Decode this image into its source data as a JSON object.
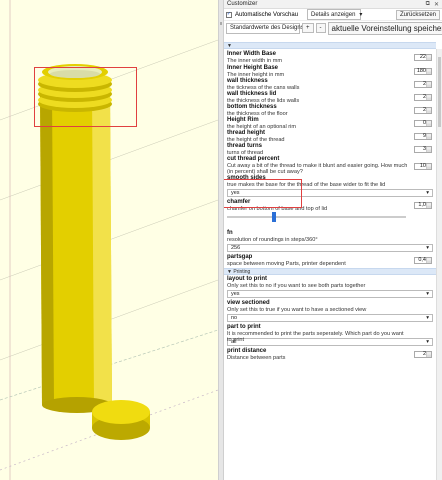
{
  "window": {
    "title": "Customizer",
    "controls": [
      "–",
      "⧉",
      "✕"
    ]
  },
  "toolbar": {
    "auto_preview_label": "Automatische Vorschau",
    "auto_preview_checked": true,
    "show_details": "Details anzeigen",
    "reset_label": "Zurücksetzen"
  },
  "presets": {
    "selected": "Standardwerte des Designs",
    "add_label": "+",
    "remove_label": "-",
    "save_label": "aktuelle Voreinstellung speichern"
  },
  "parameters": [
    {
      "name": "Inner Width Base",
      "desc": "The inner width in mm",
      "value": "22"
    },
    {
      "name": "Inner Height Base",
      "desc": "The inner height in mm",
      "value": "180"
    },
    {
      "name": "wall thickness",
      "desc": "the tickness of the cans walls",
      "value": "2"
    },
    {
      "name": "wall thickness lid",
      "desc": "the thickness of the lids walls",
      "value": "2"
    },
    {
      "name": "bottom thickness",
      "desc": "the thickness of the floor",
      "value": "2"
    },
    {
      "name": "Height Rim",
      "desc": "the height of an optional rim",
      "value": "0"
    },
    {
      "name": "thread height",
      "desc": "the height of the thread",
      "value": "9"
    },
    {
      "name": "thread turns",
      "desc": "turns of thread",
      "value": "3"
    },
    {
      "name": "cut thread percent",
      "desc": "Cut away a bit of the thread to make it blunt and easier going. How much (in percent) shall be cut away?",
      "value": "10"
    }
  ],
  "smooth_sides": {
    "name": "smooth sides",
    "desc": "true makes the base for the thread of the base wider to fit the lid",
    "value": "yes"
  },
  "chamfer": {
    "name": "chamfer",
    "desc": "chamfer on bottom of base and top of lid",
    "value": "1,0",
    "slider_fraction": 0.25
  },
  "fn": {
    "name": "fn",
    "desc": "resolution of roundings in steps/360°",
    "value": "256"
  },
  "partsgap": {
    "name": "partsgap",
    "desc": "space between moving Parts, printer dependent",
    "value": "0,4"
  },
  "printing_section": "Printing",
  "layout_to_print": {
    "name": "layout to print",
    "desc": "Only set this to no if you want to see both parts together",
    "value": "yes"
  },
  "view_sectioned": {
    "name": "view sectioned",
    "desc": "Only set this to true if you want to have a sectioned view",
    "value": "no"
  },
  "part_to_print": {
    "name": "part to print",
    "desc": "It is recommended to print the parts seperately. Which part do you want to print",
    "value": "all"
  },
  "print_distance": {
    "name": "print distance",
    "desc": "Distance between parts",
    "value": "2"
  },
  "colors": {
    "model": "#e8d400",
    "model_shadow": "#b7a400",
    "viewport_bg": "#ffffe5",
    "highlight": "#e04040",
    "section": "#dce8f7"
  }
}
